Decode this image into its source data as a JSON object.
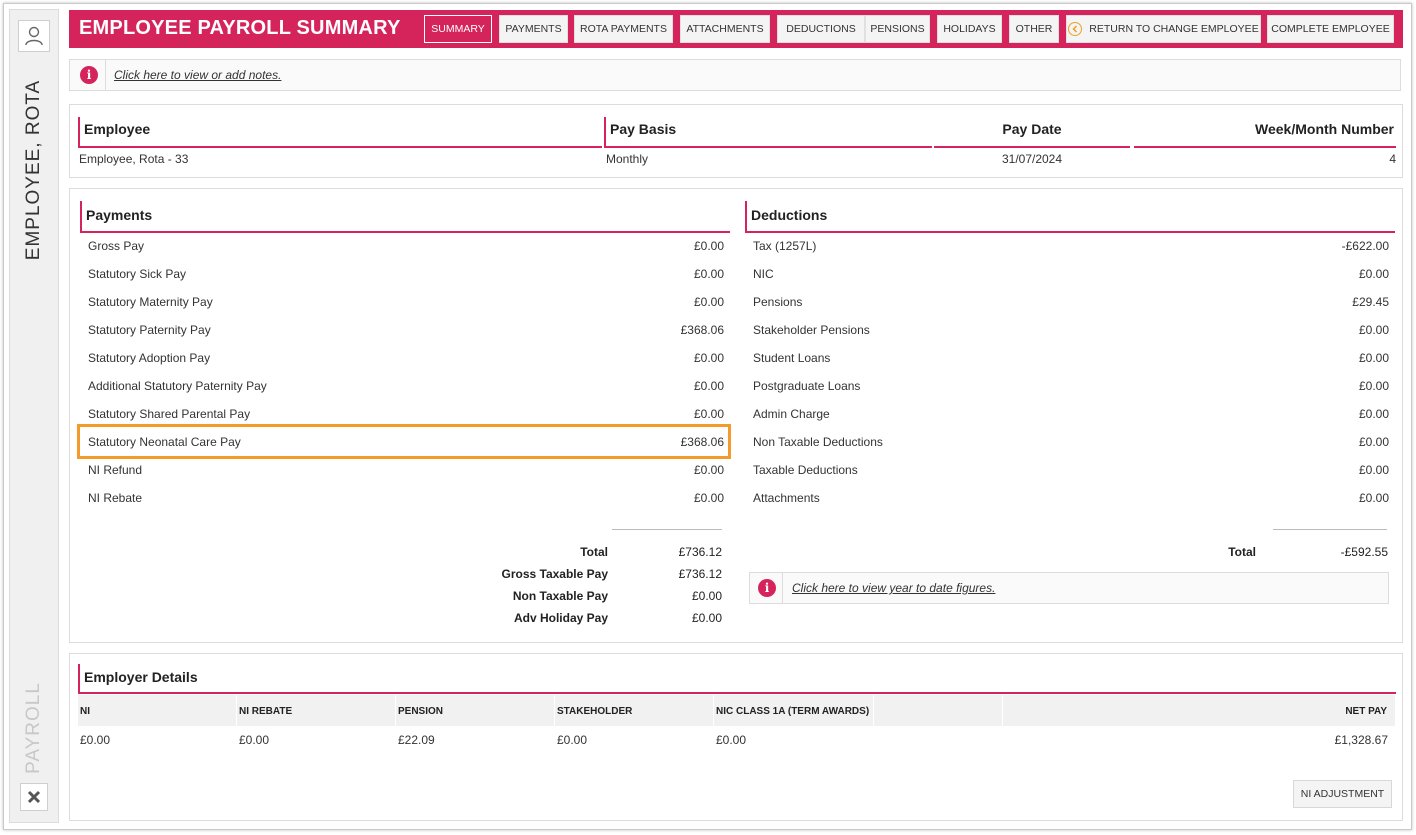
{
  "sidebar": {
    "employee_name": "EMPLOYEE, ROTA",
    "section": "PAYROLL"
  },
  "header": {
    "title": "EMPLOYEE PAYROLL SUMMARY",
    "nav": [
      "SUMMARY",
      "PAYMENTS",
      "ROTA PAYMENTS",
      "ATTACHMENTS",
      "DEDUCTIONS",
      "PENSIONS",
      "HOLIDAYS",
      "OTHER",
      "RETURN TO CHANGE EMPLOYEE",
      "COMPLETE EMPLOYEE"
    ],
    "active_tab": "SUMMARY"
  },
  "notes": {
    "link": "Click here to view or add notes."
  },
  "employee": {
    "headers": [
      "Employee",
      "Pay Basis",
      "Pay Date",
      "Week/Month Number"
    ],
    "values": [
      "Employee, Rota - 33",
      "Monthly",
      "31/07/2024",
      "4"
    ]
  },
  "payments": {
    "title": "Payments",
    "rows": [
      {
        "label": "Gross Pay",
        "value": "£0.00"
      },
      {
        "label": "Statutory Sick Pay",
        "value": "£0.00"
      },
      {
        "label": "Statutory Maternity Pay",
        "value": "£0.00"
      },
      {
        "label": "Statutory Paternity Pay",
        "value": "£368.06"
      },
      {
        "label": "Statutory Adoption Pay",
        "value": "£0.00"
      },
      {
        "label": "Additional Statutory Paternity Pay",
        "value": "£0.00"
      },
      {
        "label": "Statutory Shared Parental Pay",
        "value": "£0.00"
      },
      {
        "label": "Statutory Neonatal Care Pay",
        "value": "£368.06"
      },
      {
        "label": "NI Refund",
        "value": "£0.00"
      },
      {
        "label": "NI Rebate",
        "value": "£0.00"
      }
    ],
    "totals": [
      {
        "label": "Total",
        "value": "£736.12"
      },
      {
        "label": "Gross Taxable Pay",
        "value": "£736.12"
      },
      {
        "label": "Non Taxable Pay",
        "value": "£0.00"
      },
      {
        "label": "Adv Holiday Pay",
        "value": "£0.00"
      }
    ]
  },
  "deductions": {
    "title": "Deductions",
    "rows": [
      {
        "label": "Tax (1257L)",
        "value": "-£622.00"
      },
      {
        "label": "NIC",
        "value": "£0.00"
      },
      {
        "label": "Pensions",
        "value": "£29.45"
      },
      {
        "label": "Stakeholder Pensions",
        "value": "£0.00"
      },
      {
        "label": "Student Loans",
        "value": "£0.00"
      },
      {
        "label": "Postgraduate Loans",
        "value": "£0.00"
      },
      {
        "label": "Admin Charge",
        "value": "£0.00"
      },
      {
        "label": "Non Taxable Deductions",
        "value": "£0.00"
      },
      {
        "label": "Taxable Deductions",
        "value": "£0.00"
      },
      {
        "label": "Attachments",
        "value": "£0.00"
      }
    ],
    "total_label": "Total",
    "total_value": "-£592.55",
    "ytd_link": "Click here to view year to date figures."
  },
  "employer": {
    "title": "Employer Details",
    "headers": [
      "NI",
      "NI REBATE",
      "PENSION",
      "STAKEHOLDER",
      "NIC CLASS 1A (TERM AWARDS)",
      "NET PAY"
    ],
    "values": [
      "£0.00",
      "£0.00",
      "£22.09",
      "£0.00",
      "£0.00",
      "£1,328.67"
    ],
    "ni_adjustment_label": "NI ADJUSTMENT"
  },
  "colors": {
    "accent": "#d5245b",
    "highlight": "#f39a2b"
  }
}
